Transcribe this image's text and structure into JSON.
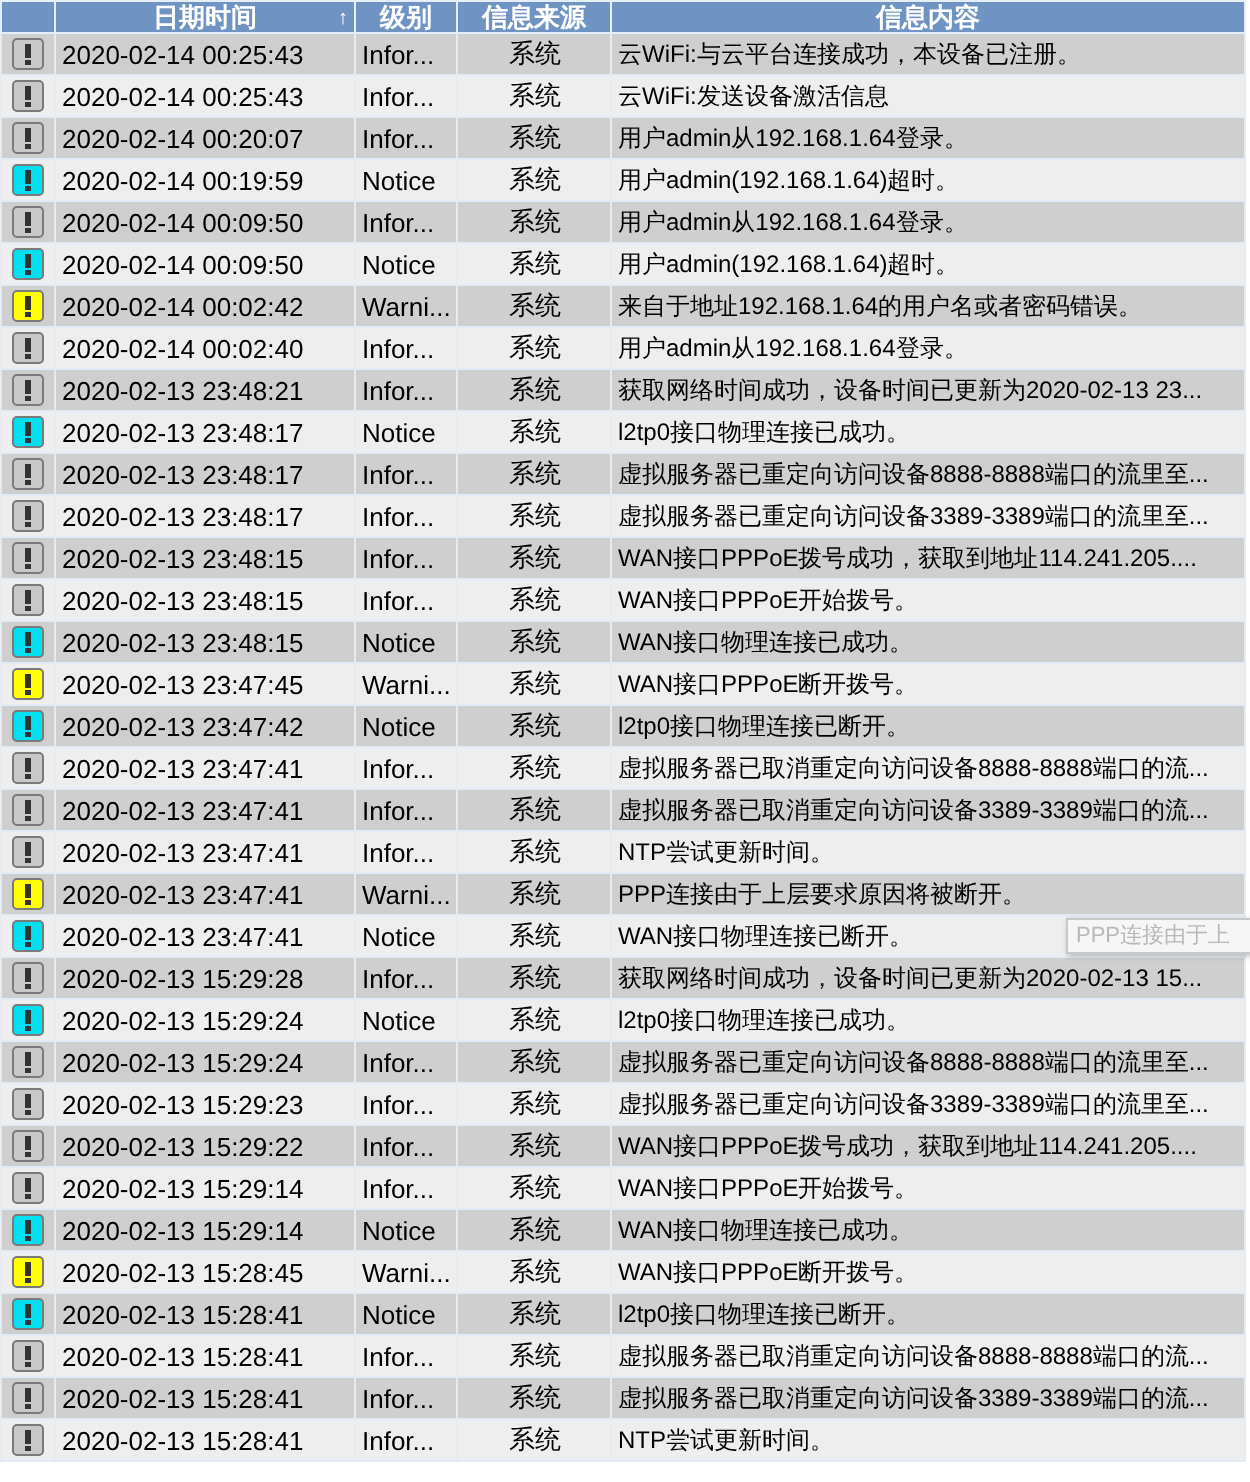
{
  "table": {
    "columns": [
      {},
      {
        "label": "日期时间",
        "sort": "↑"
      },
      {
        "label": "级别"
      },
      {
        "label": "信息来源"
      },
      {
        "label": "信息内容"
      }
    ],
    "rows": [
      {
        "kind": "info",
        "time": "2020-02-14 00:25:43",
        "level": "Infor...",
        "source": "系统",
        "message": "云WiFi:与云平台连接成功，本设备已注册。"
      },
      {
        "kind": "info",
        "time": "2020-02-14 00:25:43",
        "level": "Infor...",
        "source": "系统",
        "message": "云WiFi:发送设备激活信息"
      },
      {
        "kind": "info",
        "time": "2020-02-14 00:20:07",
        "level": "Infor...",
        "source": "系统",
        "message": "用户admin从192.168.1.64登录。"
      },
      {
        "kind": "notice",
        "time": "2020-02-14 00:19:59",
        "level": "Notice",
        "source": "系统",
        "message": "用户admin(192.168.1.64)超时。"
      },
      {
        "kind": "info",
        "time": "2020-02-14 00:09:50",
        "level": "Infor...",
        "source": "系统",
        "message": "用户admin从192.168.1.64登录。"
      },
      {
        "kind": "notice",
        "time": "2020-02-14 00:09:50",
        "level": "Notice",
        "source": "系统",
        "message": "用户admin(192.168.1.64)超时。"
      },
      {
        "kind": "warning",
        "time": "2020-02-14 00:02:42",
        "level": "Warni...",
        "source": "系统",
        "message": "来自于地址192.168.1.64的用户名或者密码错误。"
      },
      {
        "kind": "info",
        "time": "2020-02-14 00:02:40",
        "level": "Infor...",
        "source": "系统",
        "message": "用户admin从192.168.1.64登录。"
      },
      {
        "kind": "info",
        "time": "2020-02-13 23:48:21",
        "level": "Infor...",
        "source": "系统",
        "message": "获取网络时间成功，设备时间已更新为2020-02-13 23..."
      },
      {
        "kind": "notice",
        "time": "2020-02-13 23:48:17",
        "level": "Notice",
        "source": "系统",
        "message": "l2tp0接口物理连接已成功。"
      },
      {
        "kind": "info",
        "time": "2020-02-13 23:48:17",
        "level": "Infor...",
        "source": "系统",
        "message": "虚拟服务器已重定向访问设备8888-8888端口的流里至..."
      },
      {
        "kind": "info",
        "time": "2020-02-13 23:48:17",
        "level": "Infor...",
        "source": "系统",
        "message": "虚拟服务器已重定向访问设备3389-3389端口的流里至..."
      },
      {
        "kind": "info",
        "time": "2020-02-13 23:48:15",
        "level": "Infor...",
        "source": "系统",
        "message": "WAN接口PPPoE拨号成功，获取到地址114.241.205...."
      },
      {
        "kind": "info",
        "time": "2020-02-13 23:48:15",
        "level": "Infor...",
        "source": "系统",
        "message": "WAN接口PPPoE开始拨号。"
      },
      {
        "kind": "notice",
        "time": "2020-02-13 23:48:15",
        "level": "Notice",
        "source": "系统",
        "message": "WAN接口物理连接已成功。"
      },
      {
        "kind": "warning",
        "time": "2020-02-13 23:47:45",
        "level": "Warni...",
        "source": "系统",
        "message": "WAN接口PPPoE断开拨号。"
      },
      {
        "kind": "notice",
        "time": "2020-02-13 23:47:42",
        "level": "Notice",
        "source": "系统",
        "message": "l2tp0接口物理连接已断开。"
      },
      {
        "kind": "info",
        "time": "2020-02-13 23:47:41",
        "level": "Infor...",
        "source": "系统",
        "message": "虚拟服务器已取消重定向访问设备8888-8888端口的流..."
      },
      {
        "kind": "info",
        "time": "2020-02-13 23:47:41",
        "level": "Infor...",
        "source": "系统",
        "message": "虚拟服务器已取消重定向访问设备3389-3389端口的流..."
      },
      {
        "kind": "info",
        "time": "2020-02-13 23:47:41",
        "level": "Infor...",
        "source": "系统",
        "message": "NTP尝试更新时间。"
      },
      {
        "kind": "warning",
        "time": "2020-02-13 23:47:41",
        "level": "Warni...",
        "source": "系统",
        "message": "PPP连接由于上层要求原因将被断开。"
      },
      {
        "kind": "notice",
        "time": "2020-02-13 23:47:41",
        "level": "Notice",
        "source": "系统",
        "message": "WAN接口物理连接已断开。"
      },
      {
        "kind": "info",
        "time": "2020-02-13 15:29:28",
        "level": "Infor...",
        "source": "系统",
        "message": "获取网络时间成功，设备时间已更新为2020-02-13 15..."
      },
      {
        "kind": "notice",
        "time": "2020-02-13 15:29:24",
        "level": "Notice",
        "source": "系统",
        "message": "l2tp0接口物理连接已成功。"
      },
      {
        "kind": "info",
        "time": "2020-02-13 15:29:24",
        "level": "Infor...",
        "source": "系统",
        "message": "虚拟服务器已重定向访问设备8888-8888端口的流里至..."
      },
      {
        "kind": "info",
        "time": "2020-02-13 15:29:23",
        "level": "Infor...",
        "source": "系统",
        "message": "虚拟服务器已重定向访问设备3389-3389端口的流里至..."
      },
      {
        "kind": "info",
        "time": "2020-02-13 15:29:22",
        "level": "Infor...",
        "source": "系统",
        "message": "WAN接口PPPoE拨号成功，获取到地址114.241.205...."
      },
      {
        "kind": "info",
        "time": "2020-02-13 15:29:14",
        "level": "Infor...",
        "source": "系统",
        "message": "WAN接口PPPoE开始拨号。"
      },
      {
        "kind": "notice",
        "time": "2020-02-13 15:29:14",
        "level": "Notice",
        "source": "系统",
        "message": "WAN接口物理连接已成功。"
      },
      {
        "kind": "warning",
        "time": "2020-02-13 15:28:45",
        "level": "Warni...",
        "source": "系统",
        "message": "WAN接口PPPoE断开拨号。"
      },
      {
        "kind": "notice",
        "time": "2020-02-13 15:28:41",
        "level": "Notice",
        "source": "系统",
        "message": "l2tp0接口物理连接已断开。"
      },
      {
        "kind": "info",
        "time": "2020-02-13 15:28:41",
        "level": "Infor...",
        "source": "系统",
        "message": "虚拟服务器已取消重定向访问设备8888-8888端口的流..."
      },
      {
        "kind": "info",
        "time": "2020-02-13 15:28:41",
        "level": "Infor...",
        "source": "系统",
        "message": "虚拟服务器已取消重定向访问设备3389-3389端口的流..."
      },
      {
        "kind": "info",
        "time": "2020-02-13 15:28:41",
        "level": "Infor...",
        "source": "系统",
        "message": "NTP尝试更新时间。"
      }
    ]
  },
  "tooltip": {
    "text": "PPP连接由于上"
  }
}
